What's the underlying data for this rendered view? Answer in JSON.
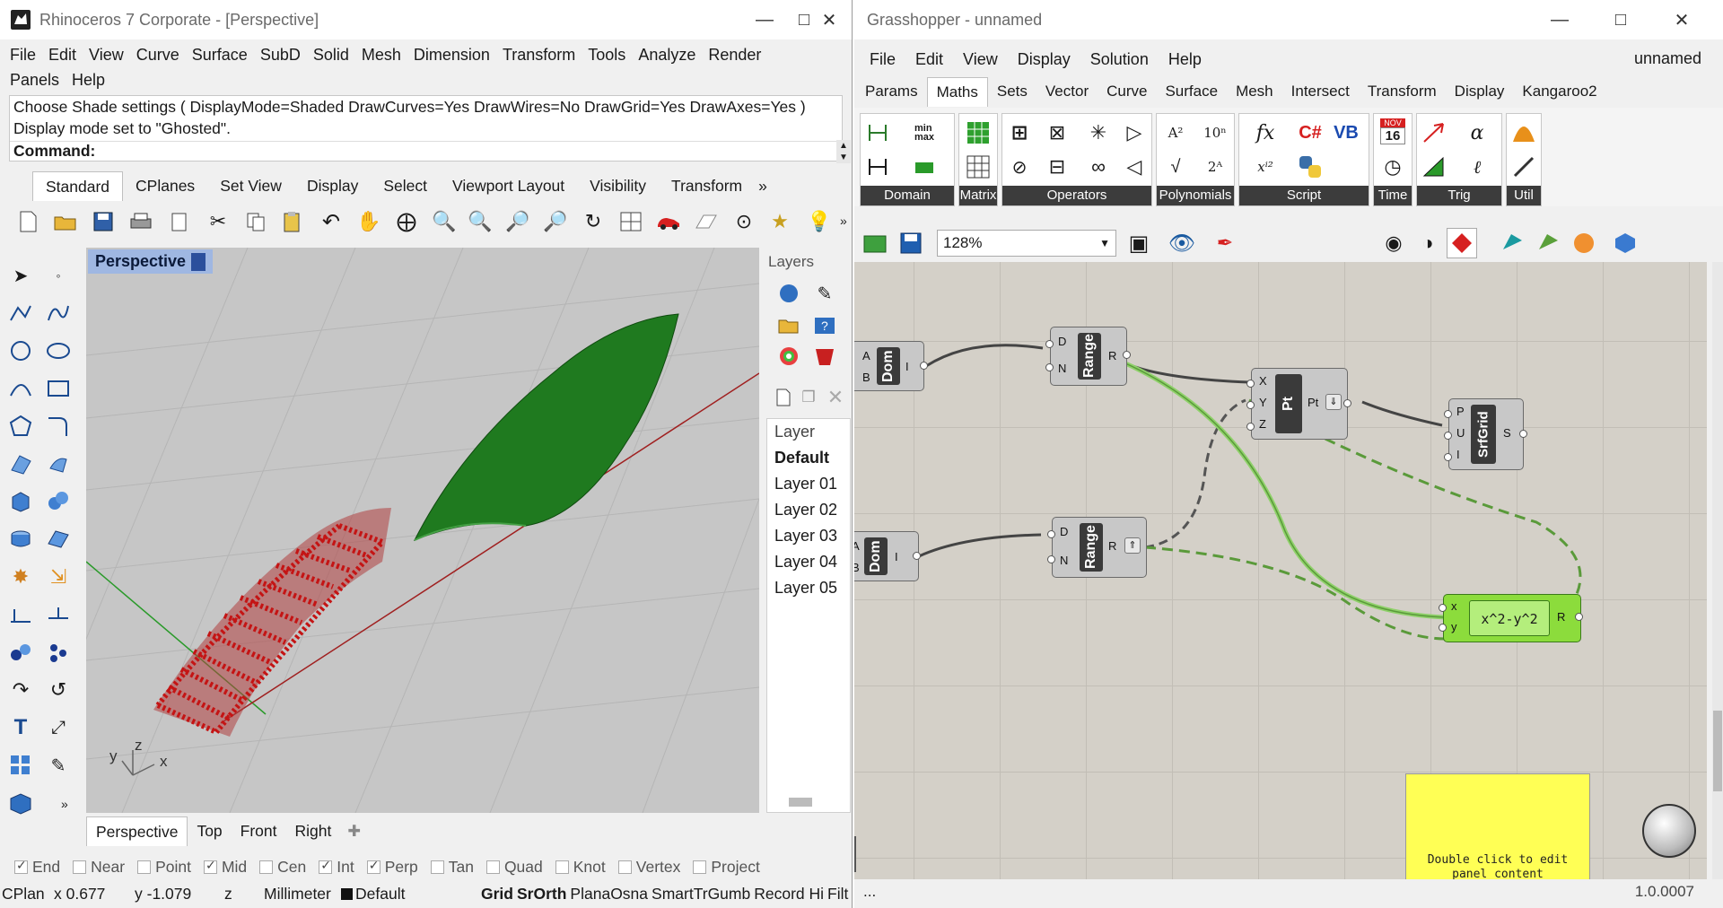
{
  "rhino": {
    "title": "Rhinoceros 7 Corporate - [Perspective]",
    "menu": [
      "File",
      "Edit",
      "View",
      "Curve",
      "Surface",
      "SubD",
      "Solid",
      "Mesh",
      "Dimension",
      "Transform",
      "Tools",
      "Analyze",
      "Render",
      "Panels",
      "Help"
    ],
    "history": [
      "Choose Shade settings ( DisplayMode=Shaded  DrawCurves=Yes  DrawWires=No  DrawGrid=Yes  DrawAxes=Yes )",
      "Display mode set to \"Ghosted\"."
    ],
    "command_label": "Command:",
    "toolbar_tabs": [
      "Standard",
      "CPlanes",
      "Set View",
      "Display",
      "Select",
      "Viewport Layout",
      "Visibility",
      "Transform"
    ],
    "more_tabs": "»",
    "viewport_title": "Perspective",
    "axis_labels": {
      "x": "x",
      "y": "y",
      "z": "z"
    },
    "viewport_tabs": [
      "Perspective",
      "Top",
      "Front",
      "Right"
    ],
    "layers": {
      "title": "Layers",
      "header": "Layer",
      "items": [
        "Default",
        "Layer 01",
        "Layer 02",
        "Layer 03",
        "Layer 04",
        "Layer 05"
      ]
    },
    "osnaps": [
      {
        "label": "End",
        "checked": true
      },
      {
        "label": "Near",
        "checked": false
      },
      {
        "label": "Point",
        "checked": false
      },
      {
        "label": "Mid",
        "checked": true
      },
      {
        "label": "Cen",
        "checked": false
      },
      {
        "label": "Int",
        "checked": true
      },
      {
        "label": "Perp",
        "checked": true
      },
      {
        "label": "Tan",
        "checked": false
      },
      {
        "label": "Quad",
        "checked": false
      },
      {
        "label": "Knot",
        "checked": false
      },
      {
        "label": "Vertex",
        "checked": false
      },
      {
        "label": "Project",
        "checked": false
      }
    ],
    "status": {
      "cplane": "CPlan",
      "x": "x 0.677",
      "y": "y -1.079",
      "z": "z",
      "units": "Millimeter",
      "layer": "Default",
      "grid": "Grid",
      "srf": "SrOrth",
      "planar": "Plana",
      "osnap": "Osna",
      "smarttrack": "SmartTr",
      "gumball": "Gumb",
      "record": "Record Hi",
      "filter": "Filt"
    }
  },
  "gh": {
    "title": "Grasshopper - unnamed",
    "menu": [
      "File",
      "Edit",
      "View",
      "Display",
      "Solution",
      "Help"
    ],
    "doc_name": "unnamed",
    "tabs": [
      "Params",
      "Maths",
      "Sets",
      "Vector",
      "Curve",
      "Surface",
      "Mesh",
      "Intersect",
      "Transform",
      "Display",
      "Kangaroo2"
    ],
    "active_tab": "Maths",
    "groups": [
      "Domain",
      "Matrix",
      "Operators",
      "Polynomials",
      "Script",
      "Time",
      "Trig",
      "Util"
    ],
    "calendar": {
      "month": "NOV",
      "day": "16"
    },
    "zoom": "128%",
    "components": {
      "dom1": {
        "name": "Dom",
        "in": [
          "A",
          "B"
        ],
        "out": "I"
      },
      "range1": {
        "name": "Range",
        "in": [
          "D",
          "N"
        ],
        "out": "R"
      },
      "pt": {
        "name": "Pt",
        "in": [
          "X",
          "Y",
          "Z"
        ],
        "out": "Pt"
      },
      "srfgrid": {
        "name": "SrfGrid",
        "in": [
          "P",
          "U",
          "I"
        ],
        "out": "S"
      },
      "dom2": {
        "name": "Dom",
        "in": [
          "A",
          "B"
        ],
        "out": "I"
      },
      "range2": {
        "name": "Range",
        "in": [
          "D",
          "N"
        ],
        "out": "R"
      },
      "expr": {
        "expression": "x^2-y^2",
        "in": [
          "x",
          "y"
        ],
        "out": "R"
      }
    },
    "panel_text": "Double click to edit panel content",
    "status_left": "...",
    "version": "1.0.0007"
  },
  "colors": {
    "surface_green": "#1f7a1f",
    "points_red": "#c41414",
    "wire_green": "#8fd16a",
    "expr_green": "#8cdc3c",
    "panel_yellow": "#ffff55"
  }
}
